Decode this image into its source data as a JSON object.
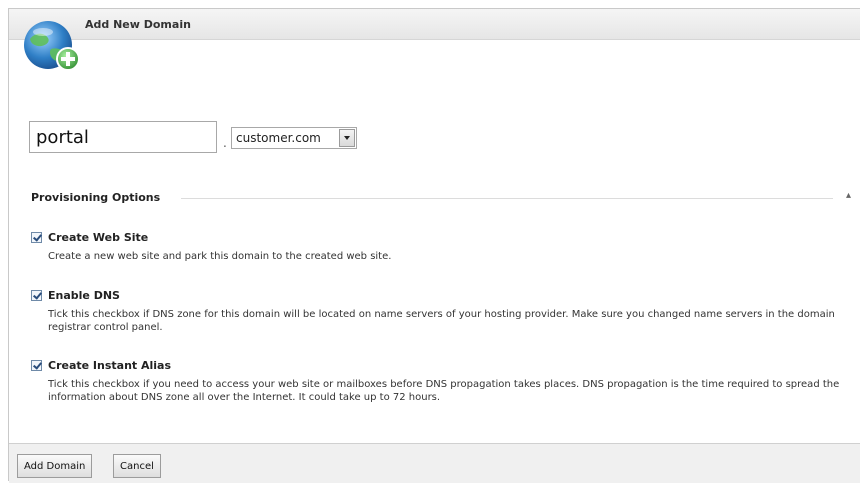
{
  "header": {
    "title": "Add New Domain"
  },
  "domain": {
    "name_value": "portal",
    "separator": ".",
    "zone_value": "customer.com"
  },
  "provisioning": {
    "section_title": "Provisioning Options",
    "collapse_glyph": "▴",
    "options": [
      {
        "label": "Create Web Site",
        "checked": true,
        "description": "Create a new web site and park this domain to the created web site."
      },
      {
        "label": "Enable DNS",
        "checked": true,
        "description": "Tick this checkbox if DNS zone for this domain will be located on name servers of your hosting provider. Make sure you changed name servers in the domain registrar control panel."
      },
      {
        "label": "Create Instant Alias",
        "checked": true,
        "description": "Tick this checkbox if you need to access your web site or mailboxes before DNS propagation takes places. DNS propagation is the time required to spread the information about DNS zone all over the Internet. It could take up to 72 hours."
      }
    ]
  },
  "footer": {
    "add_label": "Add Domain",
    "cancel_label": "Cancel"
  },
  "icons": {
    "header": "globe-add-icon"
  },
  "colors": {
    "accent": "#2e8b2e",
    "globe": "#2f7fc6"
  }
}
